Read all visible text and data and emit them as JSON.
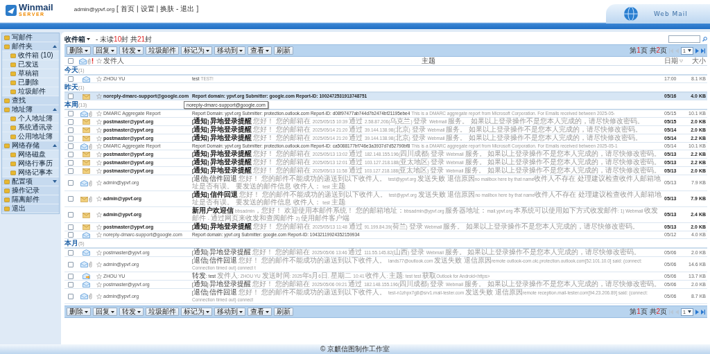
{
  "header": {
    "logo": "Winmail",
    "logo_sub": "SERVER",
    "user": "admin@ypvf.org",
    "links": [
      "[",
      "首页",
      "|",
      "设置",
      "|",
      "换肤",
      "-",
      "退出",
      "]"
    ],
    "brand": "Web Mail"
  },
  "sidebar": {
    "items": [
      {
        "label": "写邮件"
      },
      {
        "label": "邮件夹",
        "expanded": true,
        "children": [
          {
            "label": "收件箱 (10)"
          },
          {
            "label": "已发送"
          },
          {
            "label": "草稿箱"
          },
          {
            "label": "已删除"
          },
          {
            "label": "垃圾邮件"
          }
        ]
      },
      {
        "label": "查找"
      },
      {
        "label": "地址簿",
        "expanded": true,
        "children": [
          {
            "label": "个人地址簿"
          },
          {
            "label": "系统通讯录"
          },
          {
            "label": "公用地址簿"
          }
        ]
      },
      {
        "label": "网络存储",
        "expanded": true,
        "children": [
          {
            "label": "网络磁盘"
          },
          {
            "label": "网络行事历"
          },
          {
            "label": "网络记事本"
          }
        ]
      },
      {
        "label": "配置项",
        "expanded": false
      },
      {
        "label": "操作记录"
      },
      {
        "label": "隔离邮件"
      },
      {
        "label": "退出"
      }
    ]
  },
  "folder": {
    "title": "收件箱",
    "summary": [
      {
        "text": "- 未读",
        "kind": "plain"
      },
      {
        "text": "10",
        "kind": "count"
      },
      {
        "text": "封 共",
        "kind": "plain"
      },
      {
        "text": "21",
        "kind": "count"
      },
      {
        "text": "封",
        "kind": "plain"
      }
    ]
  },
  "top_bar": {
    "toolbar": [
      {
        "label": "删除",
        "menu": true
      },
      {
        "label": "回复",
        "menu": true
      },
      {
        "label": "转发",
        "menu": true
      },
      {
        "label": "垃圾邮件",
        "menu": false
      },
      {
        "label": "标记为",
        "menu": true
      },
      {
        "label": "移动到",
        "menu": true
      },
      {
        "label": "查看",
        "menu": true
      },
      {
        "label": "刷新",
        "menu": false
      }
    ],
    "pager": {
      "parts": [
        {
          "text": "第",
          "kind": "plain"
        },
        {
          "text": "1",
          "kind": "count"
        },
        {
          "text": "页 共",
          "kind": "plain"
        },
        {
          "text": "2",
          "kind": "count"
        },
        {
          "text": "页",
          "kind": "plain"
        }
      ],
      "page": "1"
    }
  },
  "table": {
    "select_all": {
      "checked": false
    },
    "columns": [
      {
        "label": "发件人",
        "sorted": false
      },
      {
        "label": "主题",
        "sorted": false
      },
      {
        "label": "日期",
        "sorted": true
      },
      {
        "label": "大小",
        "sorted": false
      }
    ],
    "groups": [
      {
        "label": "今天",
        "count": "(1)",
        "rows": [
          {
            "kind": "read",
            "attachment": false,
            "starred": false,
            "checked": false,
            "selected": false,
            "sender": "ZHOU YU",
            "subject": "test",
            "preview": "TEST!",
            "date": "17:00",
            "size": "8.1 KB"
          }
        ]
      },
      {
        "label": "昨天",
        "count": "(1)",
        "rows": [
          {
            "kind": "unread",
            "attachment": false,
            "starred": false,
            "checked": false,
            "selected": true,
            "sender": "noreply-dmarc-support@google.com",
            "subject": "Report domain: ypvf.org Submitter: google.com Report-ID: 1002472531913748751",
            "preview": "",
            "date": "05/16",
            "size": "4.0 KB",
            "tooltip": "noreply-dmarc-support@google.com"
          }
        ]
      },
      {
        "label": "本周",
        "count": "(13)",
        "rows": [
          {
            "kind": "read",
            "attachment": true,
            "starred": false,
            "checked": false,
            "selected": false,
            "sender": "DMARC Aggregate Report",
            "subject": "Report Domain: ypvf.org Submitter: protection.outlook.com Report-ID: d08f97477ab744d7b2474bf21195ebe4",
            "preview": "This is a DMARC aggregate report from Microsoft Corporation. For Emails received between 2025-05-",
            "date": "05/15",
            "size": "10.1 KB"
          },
          {
            "kind": "unread",
            "attachment": false,
            "starred": false,
            "checked": false,
            "selected": false,
            "sender": "postmaster@ypvf.org",
            "subject": "[通知] 异地登录提醒",
            "preview": "您好！ 您的邮箱在 2025/05/15 10:39 通过 2.58.87.206(乌克兰) 登录 Webmail 服务。 如果以上登录操作不是您本人完成的，请尽快修改密码。",
            "date": "05/15",
            "size": "2.0 KB"
          },
          {
            "kind": "unread",
            "attachment": false,
            "starred": false,
            "checked": false,
            "selected": false,
            "sender": "postmaster@ypvf.org",
            "subject": "[通知] 异地登录提醒",
            "preview": "您好！ 您的邮箱在 2025/05/14 21:20 通过 39.144.138.98(北京) 登录 Webmail 服务。 如果以上登录操作不是您本人完成的，请尽快修改密码。",
            "date": "05/14",
            "size": "2.0 KB"
          },
          {
            "kind": "unread",
            "attachment": false,
            "starred": false,
            "checked": false,
            "selected": false,
            "sender": "postmaster@ypvf.org",
            "subject": "[通知] 异地登录提醒",
            "preview": "您好！ 您的邮箱在 2025/05/14 21:20 通过 39.144.138.98(北京) 登录 Webmail 服务。 如果以上登录操作不是您本人完成的，请尽快修改密码。",
            "date": "05/14",
            "size": "2.2 KB"
          },
          {
            "kind": "read",
            "attachment": true,
            "starred": false,
            "checked": false,
            "selected": false,
            "sender": "DMARC Aggregate Report",
            "subject": "Report Domain: ypvf.org Submitter: protection.outlook.com Report-ID: ca5088177bf746e3a3937d7d52790bf8",
            "preview": "This is a DMARC aggregate report from Microsoft Corporation. For Emails received between 2025-05-1",
            "date": "05/14",
            "size": "10.1 KB"
          },
          {
            "kind": "unread",
            "attachment": false,
            "starred": false,
            "checked": false,
            "selected": false,
            "sender": "postmaster@ypvf.org",
            "subject": "[通知] 异地登录提醒",
            "preview": "您好！ 您的邮箱在 2025/05/13 13:02 通过 182.148.155.196(四川成都) 登录 Webmail 服务。 如果以上登录操作不是您本人完成的，请尽快修改密码。",
            "date": "05/13",
            "size": "2.2 KB"
          },
          {
            "kind": "unread",
            "attachment": false,
            "starred": false,
            "checked": false,
            "selected": false,
            "sender": "postmaster@ypvf.org",
            "subject": "[通知] 异地登录提醒",
            "preview": "您好！ 您的邮箱在 2025/05/13 12:01 通过 103.127.218.188(亚太地区) 登录 Webmail 服务。 如果以上登录操作不是您本人完成的，请尽快修改密码。",
            "date": "05/13",
            "size": "2.2 KB"
          },
          {
            "kind": "unread",
            "attachment": false,
            "starred": false,
            "checked": false,
            "selected": false,
            "sender": "postmaster@ypvf.org",
            "subject": "[通知] 异地登录提醒",
            "preview": "您好！ 您的邮箱在 2025/05/13 11:58 通过 103.127.218.188(亚太地区) 登录 Webmail 服务。 如果以上登录操作不是您本人完成的，请尽快修改密码。",
            "date": "05/13",
            "size": "2.0 KB"
          },
          {
            "kind": "read",
            "attachment": true,
            "starred": false,
            "checked": false,
            "selected": false,
            "sender": "admin@ypvf.org",
            "subject": "[退信] 信件回退",
            "preview": "您好！ 您的邮件不能成功的递送到以下收件人。 test@ypvf.org 发送失败 退信原因no mailbox here by that name收件人不存在 处理建议检查收件人邮箱地址是否有误。 要发送的邮件信息 收件人： test 主题:",
            "date": "05/13",
            "size": "7.9 KB"
          },
          {
            "kind": "unread",
            "attachment": true,
            "starred": false,
            "checked": false,
            "selected": false,
            "sender": "admin@ypvf.org",
            "subject": "[通知] 信件回退",
            "preview": "您好！ 您的邮件不能成功的递送到以下收件人。 test@ypvf.org 发送失败 退信原因no mailbox here by that name收件人不存在 处理建议检查收件人邮箱地址是否有误。 要发送的邮件信息 收件人： test 主题:",
            "date": "05/13",
            "size": "7.9 KB"
          },
          {
            "kind": "unread",
            "attachment": false,
            "starred": false,
            "checked": false,
            "selected": false,
            "sender": "admin@ypvf.org",
            "subject": "新用户欢迎信",
            "preview": "bbsadmin，您好！ 欢迎使用本邮件系统！ 您的邮箱地址：bbsadmin@ypvf.org 服务器地址：mail.ypvf.org 本系统可以使用如下方式收发邮件: 1) Webmail 收发邮件 - 通过网页来收发和查阅邮件 2) 使用邮件客户端",
            "date": "05/13",
            "size": "2.4 KB"
          },
          {
            "kind": "unread",
            "attachment": false,
            "starred": false,
            "checked": false,
            "selected": false,
            "sender": "postmaster@ypvf.org",
            "subject": "[通知] 异地登录提醒",
            "preview": "您好！ 您的邮箱在 2025/05/13 11:48 通过 91.199.84.39(荷兰) 登录 Webmail 服务。 如果以上登录操作不是您本人完成的，请尽快修改密码。",
            "date": "05/13",
            "size": "2.0 KB"
          },
          {
            "kind": "read",
            "attachment": false,
            "starred": false,
            "checked": false,
            "selected": false,
            "sender": "noreply-dmarc-support@google.com",
            "subject": "Report domain: ypvf.org Submitter: google.com Report-ID: 10432119924352159934",
            "preview": "",
            "date": "05/12",
            "size": "4.0 KB"
          }
        ]
      },
      {
        "label": "本月",
        "count": "(5)",
        "rows": [
          {
            "kind": "read",
            "attachment": false,
            "starred": false,
            "checked": false,
            "selected": false,
            "sender": "postmaster@ypvf.org",
            "subject": "[通知] 异地登录提醒",
            "preview": "您好！ 您的邮箱在 2025/05/06 13:46 通过 111.55.145.82(山西) 登录 Webmail 服务。 如果以上登录操作不是您本人完成的，请尽快修改密码。",
            "date": "05/06",
            "size": "2.0 KB"
          },
          {
            "kind": "read",
            "attachment": true,
            "starred": false,
            "checked": false,
            "selected": false,
            "sender": "admin@ypvf.org",
            "subject": "[退信] 信件回退",
            "preview": "您好！ 您的邮件不能成功的递送到以下收件人。 lands77@outlook.com 发送失败 退信原因remote outlook-com.olc.protection.outlook.com[52.101.10.0] said: (connect: Connection timed out) connect t",
            "date": "05/06",
            "size": "14.6 KB"
          },
          {
            "kind": "forwarded",
            "attachment": false,
            "starred": false,
            "checked": false,
            "selected": false,
            "sender": "ZHOU YU",
            "subject": "转发: test",
            "preview": "发件人: ZHOU YU 发送时间: 2025年5月6日, 星期二 10:41 收件人: 主题: test test 获取Outlook for Android<https>",
            "date": "05/06",
            "size": "13.7 KB"
          },
          {
            "kind": "read",
            "attachment": false,
            "starred": false,
            "checked": false,
            "selected": false,
            "sender": "postmaster@ypvf.org",
            "subject": "[通知] 异地登录提醒",
            "preview": "您好！ 您的邮箱在 2025/05/06 09:21 通过 182.148.155.196(四川成都) 登录 Webmail 服务。 如果以上登录操作不是您本人完成的，请尽快修改密码。",
            "date": "05/06",
            "size": "2.0 KB"
          },
          {
            "kind": "read",
            "attachment": true,
            "starred": false,
            "checked": false,
            "selected": false,
            "sender": "admin@ypvf.org",
            "subject": "[退信] 信件回退",
            "preview": "您好！ 您的邮件不能成功的递送到以下收件人。 test-n1zhpx7g8@srv1.mail-tester.com 发送失败 退信原因remote reception.mail-tester.com[94.23.206.89] said: (connect: Connection timed out) connect",
            "date": "05/06",
            "size": "8.7 KB"
          }
        ]
      }
    ]
  },
  "bottom_bar": {
    "toolbar": [
      {
        "label": "删除",
        "menu": true
      },
      {
        "label": "回复",
        "menu": true
      },
      {
        "label": "转发",
        "menu": true
      },
      {
        "label": "垃圾邮件",
        "menu": false
      },
      {
        "label": "标记为",
        "menu": true
      },
      {
        "label": "移动到",
        "menu": true
      },
      {
        "label": "查看",
        "menu": true
      },
      {
        "label": "刷新",
        "menu": false
      }
    ],
    "pager": {
      "parts": [
        {
          "text": "第",
          "kind": "plain"
        },
        {
          "text": "1",
          "kind": "count"
        },
        {
          "text": "页 共",
          "kind": "plain"
        },
        {
          "text": "2",
          "kind": "count"
        },
        {
          "text": "页",
          "kind": "plain"
        }
      ],
      "page": "1"
    }
  },
  "footer": "© 京麒信图制作工作室"
}
